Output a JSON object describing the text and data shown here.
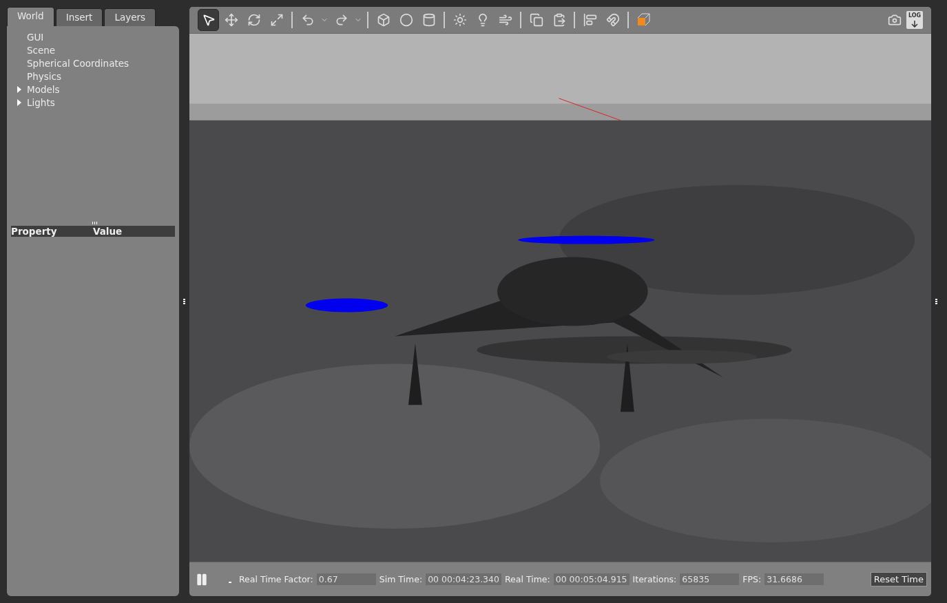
{
  "left_panel": {
    "tabs": [
      {
        "label": "World",
        "selected": true
      },
      {
        "label": "Insert",
        "selected": false
      },
      {
        "label": "Layers",
        "selected": false
      }
    ],
    "tree": [
      {
        "label": "GUI",
        "kind": "leaf"
      },
      {
        "label": "Scene",
        "kind": "leaf"
      },
      {
        "label": "Spherical Coordinates",
        "kind": "leaf"
      },
      {
        "label": "Physics",
        "kind": "leaf"
      },
      {
        "label": "Models",
        "kind": "group",
        "expanded": false
      },
      {
        "label": "Lights",
        "kind": "group",
        "expanded": false
      }
    ],
    "property_table": {
      "columns": [
        "Property",
        "Value"
      ]
    }
  },
  "toolbar": {
    "groups": [
      {
        "tools": [
          {
            "kind": "select",
            "selected": true
          },
          {
            "kind": "translate",
            "selected": false
          },
          {
            "kind": "rotate",
            "selected": false
          },
          {
            "kind": "scale",
            "selected": false
          }
        ]
      },
      {
        "tools": [
          {
            "kind": "undo",
            "selected": false
          },
          {
            "kind": "redo",
            "selected": false
          }
        ]
      },
      {
        "tools": [
          {
            "kind": "box",
            "selected": false
          },
          {
            "kind": "sphere",
            "selected": false
          },
          {
            "kind": "cylinder",
            "selected": false
          }
        ]
      },
      {
        "tools": [
          {
            "kind": "sun",
            "selected": false
          },
          {
            "kind": "pointlight",
            "selected": false
          },
          {
            "kind": "dirlight",
            "selected": false
          }
        ]
      },
      {
        "tools": [
          {
            "kind": "copy",
            "selected": false
          },
          {
            "kind": "paste",
            "selected": false
          }
        ]
      },
      {
        "tools": [
          {
            "kind": "align",
            "selected": false
          },
          {
            "kind": "magnet",
            "selected": false
          }
        ]
      },
      {
        "tools": [
          {
            "kind": "view",
            "selected": false
          }
        ]
      }
    ],
    "log_label": "LOG"
  },
  "status_bar": {
    "fields": [
      {
        "label": "Real Time Factor:",
        "value": "0.67"
      },
      {
        "label": "Sim Time:",
        "value": "00 00:04:23.340"
      },
      {
        "label": "Real Time:",
        "value": "00 00:05:04.915"
      },
      {
        "label": "Iterations:",
        "value": "65835"
      },
      {
        "label": "FPS:",
        "value": "31.6686"
      }
    ],
    "button": "Reset Time"
  }
}
